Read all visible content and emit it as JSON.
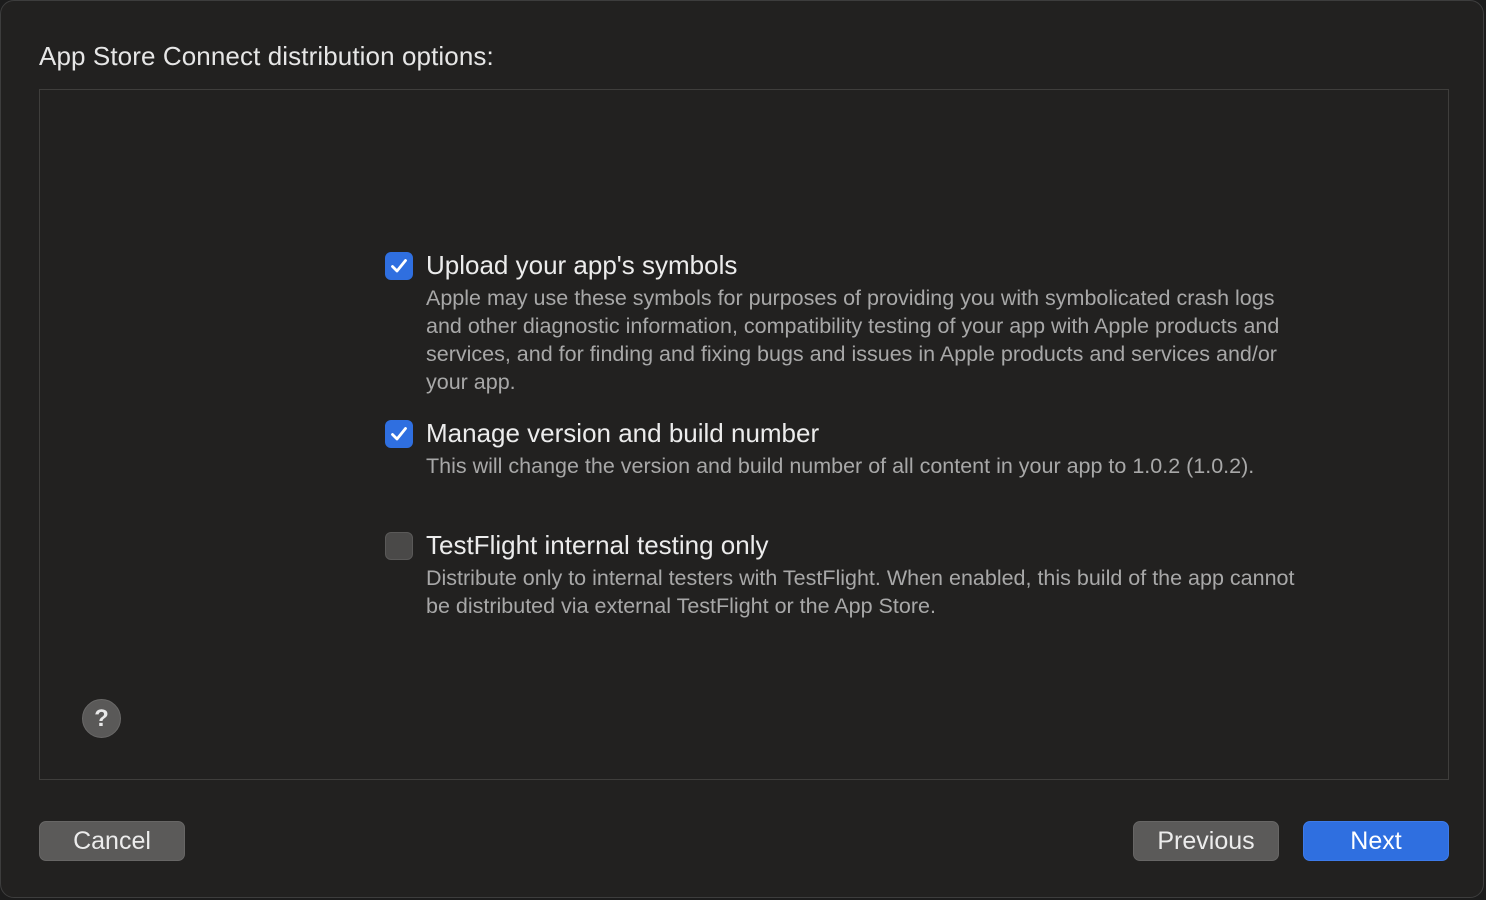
{
  "dialog": {
    "heading": "App Store Connect distribution options:"
  },
  "options": [
    {
      "title": "Upload your app's symbols",
      "description": "Apple may use these symbols for purposes of providing you with symbolicated crash logs and other diagnostic information, compatibility testing of your app with Apple products and services, and for finding and fixing bugs and issues in Apple products and services and/or your app.",
      "checked": true
    },
    {
      "title": "Manage version and build number",
      "description": "This will change the version and build number of all content in your app to 1.0.2 (1.0.2).",
      "checked": true
    },
    {
      "title": "TestFlight internal testing only",
      "description": "Distribute only to internal testers with TestFlight. When enabled, this build of the app cannot be distributed via external TestFlight or the App Store.",
      "checked": false
    }
  ],
  "help": {
    "label": "?"
  },
  "buttons": {
    "cancel": "Cancel",
    "previous": "Previous",
    "next": "Next"
  },
  "colors": {
    "accent": "#2f6fe0",
    "background": "#222120"
  }
}
